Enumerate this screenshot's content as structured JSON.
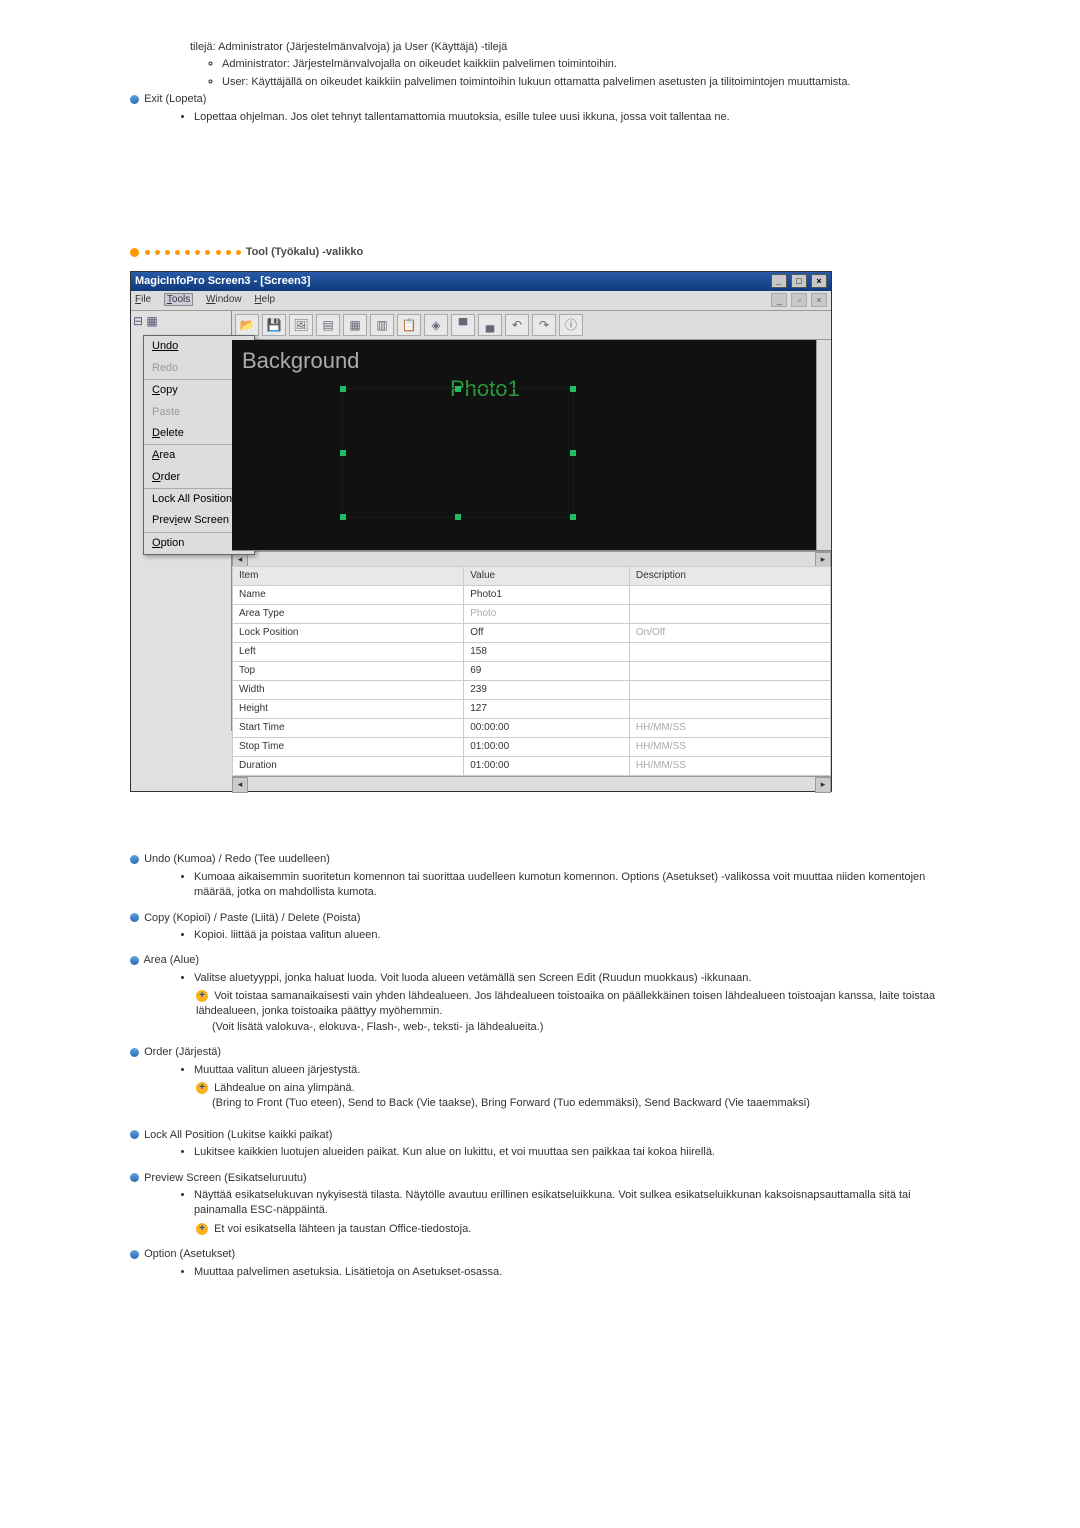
{
  "intro": {
    "line1": "tilejä: Administrator (Järjestelmänvalvoja) ja User (Käyttäjä) -tilejä",
    "admin": "Administrator: Järjestelmänvalvojalla on oikeudet kaikkiin palvelimen toimintoihin.",
    "user": "User: Käyttäjällä on oikeudet kaikkiin palvelimen toimintoihin lukuun ottamatta palvelimen asetusten ja tilitoimintojen muuttamista.",
    "exit_title": "Exit (Lopeta)",
    "exit_body": "Lopettaa ohjelman. Jos olet tehnyt tallentamattomia muutoksia, esille tulee uusi ikkuna, jossa voit tallentaa ne."
  },
  "section_title": "Tool (Työkalu) -valikko",
  "app": {
    "title": "MagicInfoPro Screen3 - [Screen3]",
    "menubar": {
      "file": "File",
      "tools": "Tools",
      "window": "Window",
      "help": "Help"
    },
    "tools_menu": {
      "undo": "Undo",
      "redo": "Redo",
      "copy": "Copy",
      "paste": "Paste",
      "delete": "Delete",
      "area": "Area",
      "order": "Order",
      "lock": "Lock All Position",
      "preview": "Preview Screen",
      "option": "Option"
    },
    "canvas": {
      "bg": "Background",
      "photo": "Photo1"
    },
    "table": {
      "headers": {
        "item": "Item",
        "value": "Value",
        "desc": "Description"
      },
      "rows": [
        {
          "item": "Name",
          "value": "Photo1",
          "desc": ""
        },
        {
          "item": "Area Type",
          "value": "Photo",
          "desc": ""
        },
        {
          "item": "Lock Position",
          "value": "Off",
          "desc": "On/Off"
        },
        {
          "item": "Left",
          "value": "158",
          "desc": ""
        },
        {
          "item": "Top",
          "value": "69",
          "desc": ""
        },
        {
          "item": "Width",
          "value": "239",
          "desc": ""
        },
        {
          "item": "Height",
          "value": "127",
          "desc": ""
        },
        {
          "item": "Start Time",
          "value": "00:00:00",
          "desc": "HH/MM/SS"
        },
        {
          "item": "Stop Time",
          "value": "01:00:00",
          "desc": "HH/MM/SS"
        },
        {
          "item": "Duration",
          "value": "01:00:00",
          "desc": "HH/MM/SS"
        }
      ]
    }
  },
  "help": {
    "undo_title": "Undo (Kumoa) / Redo (Tee uudelleen)",
    "undo_body": "Kumoaa aikaisemmin suoritetun komennon tai suorittaa uudelleen kumotun komennon. Options (Asetukset) -valikossa voit muuttaa niiden komentojen määrää, jotka on mahdollista kumota.",
    "copy_title": "Copy (Kopioi) / Paste (Liitä) / Delete (Poista)",
    "copy_body": "Kopioi. liittää ja poistaa valitun alueen.",
    "area_title": "Area (Alue)",
    "area_body": "Valitse aluetyyppi, jonka haluat luoda. Voit luoda alueen vetämällä sen Screen Edit (Ruudun muokkaus) -ikkunaan.",
    "area_note": "Voit toistaa samanaikaisesti vain yhden lähdealueen. Jos lähdealueen toistoaika on päällekkäinen toisen lähdealueen toistoajan kanssa, laite toistaa lähdealueen, jonka toistoaika päättyy myöhemmin.",
    "area_note2": "(Voit lisätä valokuva-, elokuva-, Flash-, web-, teksti- ja lähdealueita.)",
    "order_title": "Order (Järjestä)",
    "order_body": "Muuttaa valitun alueen järjestystä.",
    "order_note": "Lähdealue on aina ylimpänä.",
    "order_note2": "(Bring to Front (Tuo eteen), Send to Back (Vie taakse), Bring Forward (Tuo edemmäksi), Send Backward (Vie taaemmaksi)",
    "lock_title": "Lock All Position (Lukitse kaikki paikat)",
    "lock_body": "Lukitsee kaikkien luotujen alueiden paikat. Kun alue on lukittu, et voi muuttaa sen paikkaa tai kokoa hiirellä.",
    "preview_title": "Preview Screen (Esikatseluruutu)",
    "preview_body": "Näyttää esikatselukuvan nykyisestä tilasta. Näytölle avautuu erillinen esikatseluikkuna. Voit sulkea esikatseluikkunan kaksoisnapsauttamalla sitä tai painamalla ESC-näppäintä.",
    "preview_note": "Et voi esikatsella lähteen ja taustan Office-tiedostoja.",
    "option_title": "Option (Asetukset)",
    "option_body": "Muuttaa palvelimen asetuksia. Lisätietoja on Asetukset-osassa."
  }
}
